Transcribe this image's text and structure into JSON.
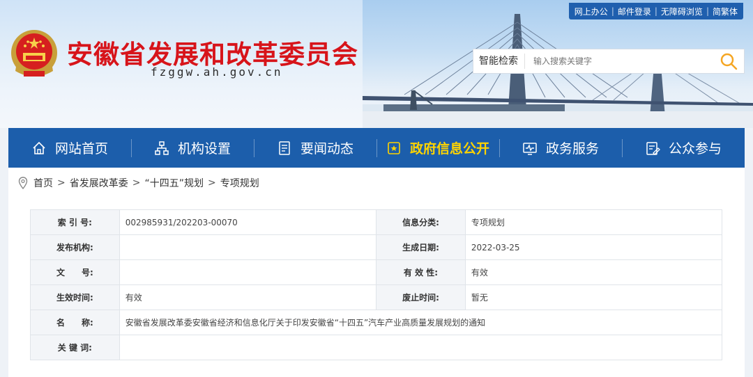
{
  "header": {
    "site_title": "安徽省发展和改革委员会",
    "site_domain": "fzggw.ah.gov.cn",
    "top_links": [
      "网上办公",
      "邮件登录",
      "无障碍浏览",
      "简繁体"
    ],
    "search": {
      "label": "智能检索",
      "placeholder": "输入搜索关键字"
    }
  },
  "nav": {
    "items": [
      {
        "label": "网站首页",
        "icon": "home-icon"
      },
      {
        "label": "机构设置",
        "icon": "org-chart-icon"
      },
      {
        "label": "要闻动态",
        "icon": "news-icon"
      },
      {
        "label": "政府信息公开",
        "icon": "info-open-icon",
        "active": true
      },
      {
        "label": "政务服务",
        "icon": "service-monitor-icon"
      },
      {
        "label": "公众参与",
        "icon": "participation-icon"
      }
    ],
    "active_color": "#ffd400",
    "bar_color": "#1c5eab"
  },
  "breadcrumb": [
    "首页",
    "省发展改革委",
    "“十四五”规划",
    "专项规划"
  ],
  "info": {
    "index_label": "索 引 号:",
    "index_value": "002985931/202203-00070",
    "category_label": "信息分类:",
    "category_value": "专项规划",
    "publisher_label": "发布机构:",
    "publisher_value": "",
    "date_label": "生成日期:",
    "date_value": "2022-03-25",
    "docno_label": "文　　号:",
    "docno_value": "",
    "validity_label": "有 效 性:",
    "validity_value": "有效",
    "effective_label": "生效时间:",
    "effective_value": "有效",
    "expire_label": "废止时间:",
    "expire_value": "暂无",
    "name_label": "名　　称:",
    "name_value": "安徽省发展改革委安徽省经济和信息化厅关于印发安徽省“十四五”汽车产业高质量发展规划的通知",
    "keywords_label": "关 键 词:",
    "keywords_value": ""
  }
}
